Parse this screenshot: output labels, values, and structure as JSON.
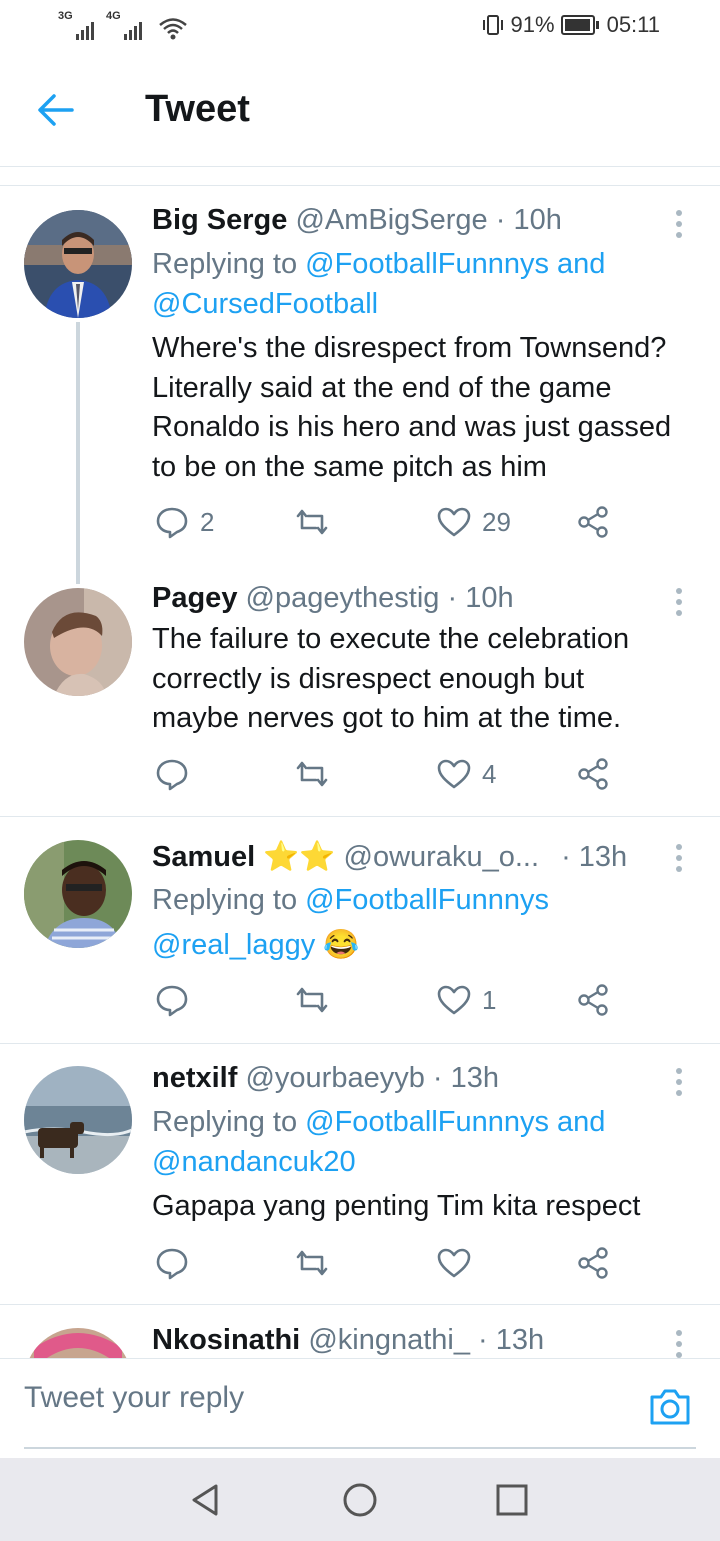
{
  "status_bar": {
    "net1": "3G",
    "net2": "4G",
    "battery": "91%",
    "time": "05:11"
  },
  "header": {
    "title": "Tweet"
  },
  "tweets": [
    {
      "name": "Big Serge",
      "handle": "@AmBigSerge",
      "time": "· 10h",
      "replying_prefix": "Replying to",
      "replying_to": "@FootballFunnnys and",
      "replying_to_2": "@CursedFootball",
      "text_lines": [
        "Where's the disrespect from Townsend?",
        "Literally said at the end of the game",
        "Ronaldo is his hero and was just gassed",
        "to be on the same pitch as him"
      ],
      "replies": "2",
      "retweets": "",
      "likes": "29"
    },
    {
      "name": "Pagey",
      "handle": "@pageythestig",
      "time": "· 10h",
      "text_lines": [
        "The failure to execute the celebration",
        "correctly is disrespect enough but",
        "maybe nerves got to him at the time."
      ],
      "replies": "",
      "retweets": "",
      "likes": "4"
    },
    {
      "name": "Samuel",
      "name_emoji": "⭐⭐",
      "handle": "@owuraku_o...",
      "time": "· 13h",
      "replying_prefix": "Replying to",
      "replying_to": "@FootballFunnnys",
      "text_mention": "@real_laggy",
      "text_emoji": "😂",
      "replies": "",
      "retweets": "",
      "likes": "1"
    },
    {
      "name": "netxilf",
      "handle": "@yourbaeyyb",
      "time": "· 13h",
      "replying_prefix": "Replying to",
      "replying_to": "@FootballFunnnys and",
      "replying_to_2": "@nandancuk20",
      "text_lines": [
        "Gapapa yang penting Tim kita respect"
      ],
      "replies": "",
      "retweets": "",
      "likes": ""
    },
    {
      "name": "Nkosinathi",
      "handle": "@kingnathi_",
      "time": "· 13h"
    }
  ],
  "reply_bar": {
    "placeholder": "Tweet your reply"
  },
  "colors": {
    "accent": "#1da1f2",
    "muted": "#657786",
    "text": "#14171a",
    "divider": "#e1e8ed"
  },
  "icons": [
    "back-arrow-icon",
    "kebab-menu-icon",
    "reply-icon",
    "retweet-icon",
    "like-icon",
    "share-icon",
    "camera-icon",
    "nav-back-icon",
    "nav-home-icon",
    "nav-recents-icon"
  ]
}
